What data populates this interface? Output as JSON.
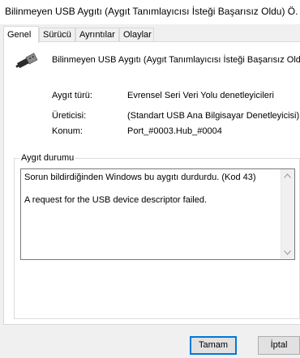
{
  "window": {
    "title": "Bilinmeyen USB Aygıtı (Aygıt Tanımlayıcısı İsteği Başarısız Oldu) Ö..."
  },
  "tabs": [
    {
      "label": "Genel",
      "active": true
    },
    {
      "label": "Sürücü",
      "active": false
    },
    {
      "label": "Ayrıntılar",
      "active": false
    },
    {
      "label": "Olaylar",
      "active": false
    }
  ],
  "device": {
    "icon": "usb-connector-icon",
    "name": "Bilinmeyen USB Aygıtı (Aygıt Tanımlayıcısı İsteği Başarısız Oldu)"
  },
  "properties": [
    {
      "label": "Aygıt türü:",
      "value": "Evrensel Seri Veri Yolu denetleyicileri"
    },
    {
      "label": "Üreticisi:",
      "value": "(Standart USB Ana Bilgisayar Denetleyicisi)"
    },
    {
      "label": "Konum:",
      "value": "Port_#0003.Hub_#0004"
    }
  ],
  "status": {
    "group_label": "Aygıt durumu",
    "text": "Sorun bildirdiğinden Windows bu aygıtı durdurdu. (Kod 43)\n\nA request for the USB device descriptor failed."
  },
  "buttons": {
    "ok_label": "Tamam",
    "cancel_label": "İptal"
  },
  "colors": {
    "accent": "#0078d7",
    "window_bg": "#f0f0f0",
    "panel_bg": "#ffffff"
  }
}
